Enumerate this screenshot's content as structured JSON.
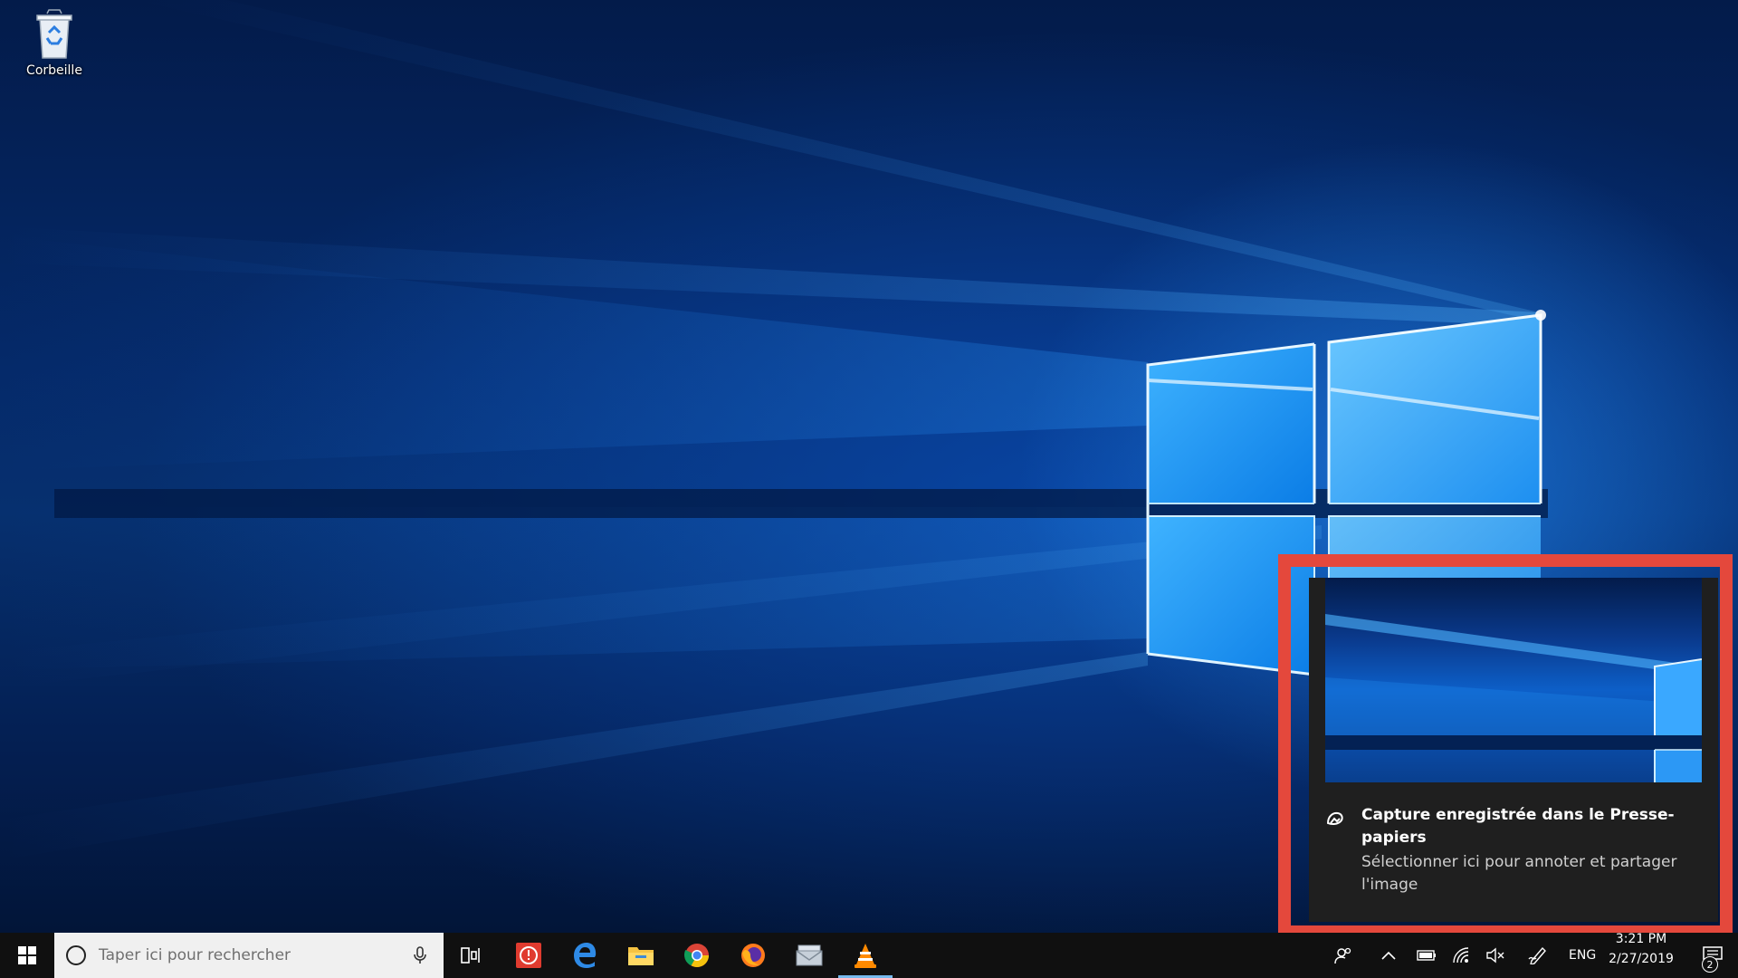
{
  "desktop": {
    "icons": [
      {
        "label": "Corbeille",
        "icon": "recycle-bin-icon"
      }
    ]
  },
  "toast": {
    "title": "Capture enregistrée dans le Presse-papiers",
    "body": "Sélectionner ici pour annoter et partager l'image",
    "icon": "snip-sketch-icon",
    "highlight_color": "#e4483c"
  },
  "taskbar": {
    "search_placeholder": "Taper ici pour rechercher",
    "pinned": [
      "task-view-icon",
      "app-red-icon",
      "edge-icon",
      "file-explorer-icon",
      "chrome-icon",
      "firefox-icon",
      "mail-icon",
      "vlc-icon"
    ],
    "tray": {
      "language": "ENG",
      "time": "3:21 PM",
      "date": "2/27/2019",
      "notification_count": "2"
    },
    "accent_color": "#76b9ed"
  }
}
